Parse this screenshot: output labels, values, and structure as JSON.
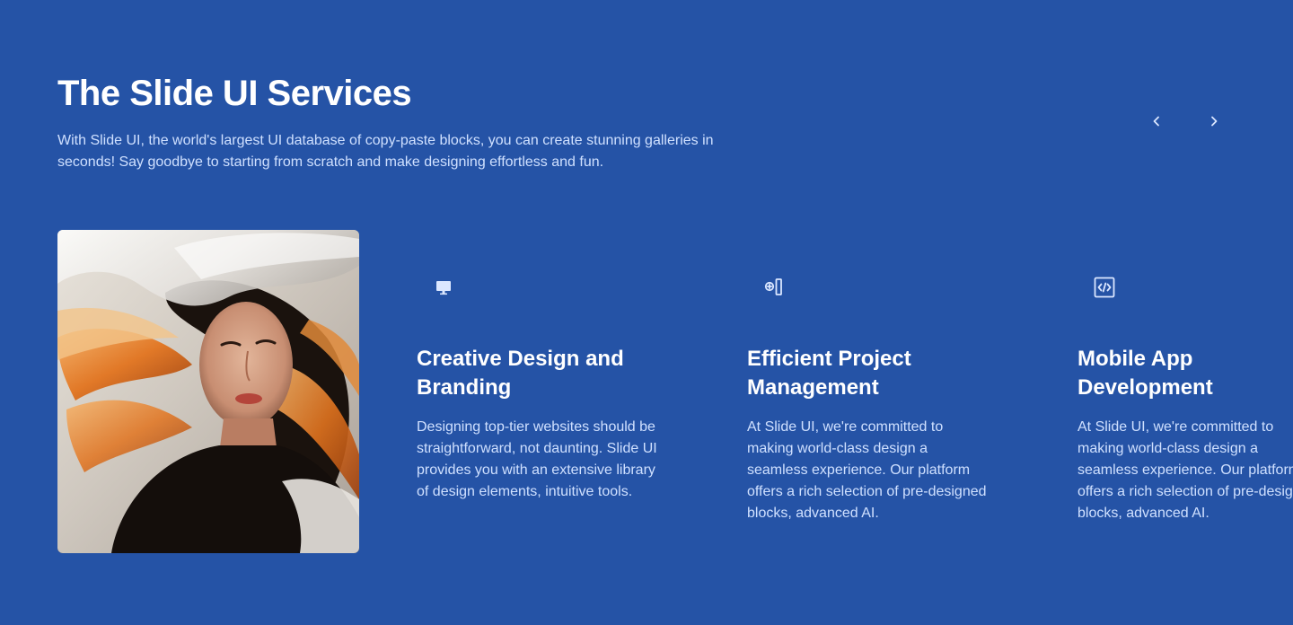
{
  "colors": {
    "background": "#2553a6",
    "title": "#ffffff",
    "body_text": "#cfe0ff",
    "icon": "#dbe7ff"
  },
  "header": {
    "title": "The Slide UI Services",
    "subtitle": "With Slide UI, the world's largest UI database of copy-paste blocks, you can create stunning galleries in seconds! Say goodbye to starting from scratch and make designing effortless and fun."
  },
  "carousel": {
    "prev_icon": "chevron-left-icon",
    "next_icon": "chevron-right-icon"
  },
  "hero_image": {
    "subject": "portrait of a woman with flowing orange and black hair under a white veil"
  },
  "services": [
    {
      "icon": "monitor-icon",
      "title": "Creative Design and Branding",
      "text": "Designing top-tier websites should be straightforward, not daunting. Slide UI provides you with an extensive library of design elements, intuitive tools."
    },
    {
      "icon": "add-column-icon",
      "title": "Efficient Project Management",
      "text": "At Slide UI, we're committed to making world-class design a seamless experience. Our platform offers a rich selection of pre-designed blocks, advanced AI."
    },
    {
      "icon": "code-icon",
      "title": "Mobile App Development",
      "text": "At Slide UI, we're committed to making world-class design a seamless experience. Our platform offers a rich selection of pre-designed blocks, advanced AI."
    }
  ]
}
